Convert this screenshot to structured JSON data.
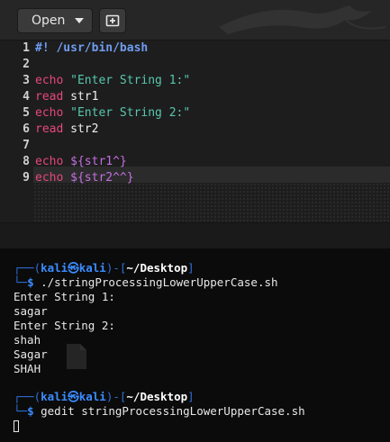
{
  "gedit": {
    "open_label": "Open",
    "icons": {
      "open_dropdown": "chevron-down-icon",
      "new_document": "new-document-icon"
    },
    "lines": [
      {
        "num": "1",
        "tokens": [
          {
            "t": "#! /usr/bin/bash",
            "c": "shebang"
          }
        ]
      },
      {
        "num": "2",
        "tokens": []
      },
      {
        "num": "3",
        "tokens": [
          {
            "t": "echo",
            "c": "kw"
          },
          {
            "t": " ",
            "c": "plain"
          },
          {
            "t": "\"Enter String 1:\"",
            "c": "str"
          }
        ]
      },
      {
        "num": "4",
        "tokens": [
          {
            "t": "read",
            "c": "kw"
          },
          {
            "t": " str1",
            "c": "plain"
          }
        ]
      },
      {
        "num": "5",
        "tokens": [
          {
            "t": "echo",
            "c": "kw"
          },
          {
            "t": " ",
            "c": "plain"
          },
          {
            "t": "\"Enter String 2:\"",
            "c": "str"
          }
        ]
      },
      {
        "num": "6",
        "tokens": [
          {
            "t": "read",
            "c": "kw"
          },
          {
            "t": " str2",
            "c": "plain"
          }
        ]
      },
      {
        "num": "7",
        "tokens": []
      },
      {
        "num": "8",
        "tokens": [
          {
            "t": "echo",
            "c": "kw"
          },
          {
            "t": " ",
            "c": "plain"
          },
          {
            "t": "${str1^}",
            "c": "var"
          }
        ]
      },
      {
        "num": "9",
        "tokens": [
          {
            "t": "echo",
            "c": "kw"
          },
          {
            "t": " ",
            "c": "plain"
          },
          {
            "t": "${str2^^}",
            "c": "var"
          }
        ]
      }
    ],
    "colors": {
      "shebang": "#6f9df0",
      "keyword": "#e5487a",
      "string": "#58c7ad",
      "variable": "#c46fe0"
    }
  },
  "terminal": {
    "prompt1": {
      "box_top": "┌──(",
      "user": "kali㉿kali",
      "sep_open": ")-[",
      "path": "~/Desktop",
      "sep_close": "]",
      "box_bottom": "└─",
      "dollar": "$",
      "command": " ./stringProcessingLowerUpperCase.sh"
    },
    "output": [
      "Enter String 1:",
      "sagar",
      "Enter String 2:",
      "shah",
      "Sagar",
      "SHAH"
    ],
    "prompt2": {
      "box_top": "┌──(",
      "user": "kali㉿kali",
      "sep_open": ")-[",
      "path": "~/Desktop",
      "sep_close": "]",
      "box_bottom": "└─",
      "dollar": "$",
      "command": " gedit stringProcessingLowerUpperCase.sh"
    },
    "colors": {
      "prompt_accent": "#3b8cff",
      "background": "#0b0b0b"
    }
  }
}
